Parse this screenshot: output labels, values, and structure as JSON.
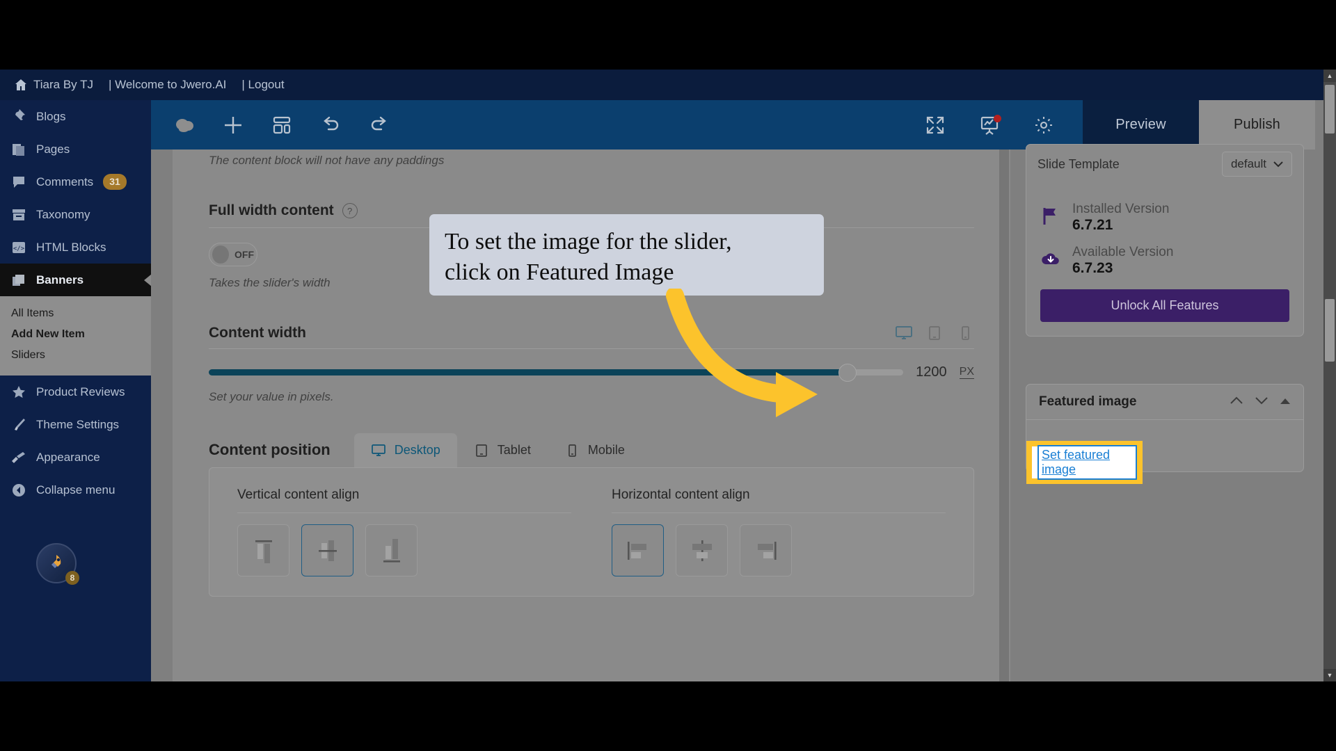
{
  "adminbar": {
    "site_title": "Tiara By TJ",
    "welcome": "| Welcome to Jwero.AI",
    "logout": "| Logout"
  },
  "sidebar": {
    "items": [
      {
        "label": "Blogs",
        "icon": "pin-icon",
        "badge": null,
        "current": false
      },
      {
        "label": "Pages",
        "icon": "pages-icon",
        "badge": null,
        "current": false
      },
      {
        "label": "Comments",
        "icon": "comment-icon",
        "badge": "31",
        "current": false
      },
      {
        "label": "Taxonomy",
        "icon": "archive-icon",
        "badge": null,
        "current": false
      },
      {
        "label": "HTML Blocks",
        "icon": "code-icon",
        "badge": null,
        "current": false
      },
      {
        "label": "Banners",
        "icon": "layers-icon",
        "badge": null,
        "current": true
      }
    ],
    "submenu": [
      {
        "label": "All Items",
        "bold": false
      },
      {
        "label": "Add New Item",
        "bold": true
      },
      {
        "label": "Sliders",
        "bold": false
      }
    ],
    "items_after": [
      {
        "label": "Product Reviews",
        "icon": "star-icon"
      },
      {
        "label": "Theme Settings",
        "icon": "brush-icon"
      },
      {
        "label": "Appearance",
        "icon": "paintroller-icon"
      },
      {
        "label": "Collapse menu",
        "icon": "collapse-icon"
      }
    ],
    "rocket_badge": "8"
  },
  "toolbar": {
    "left_icons": [
      "cloud-save-icon",
      "plus-icon",
      "layout-icon",
      "undo-icon",
      "redo-icon"
    ],
    "right_icons": [
      "fullscreen-icon",
      "stats-icon",
      "gear-icon"
    ],
    "preview_label": "Preview",
    "publish_label": "Publish"
  },
  "main": {
    "paddings_hint": "The content block will not have any paddings",
    "full_width": {
      "title": "Full width content",
      "help": "?",
      "toggle_state": "OFF",
      "hint": "Takes the slider's width"
    },
    "content_width": {
      "title": "Content width",
      "value": "1200",
      "unit": "PX",
      "hint": "Set your value in pixels.",
      "fill_percent": 92
    },
    "content_position": {
      "label": "Content position",
      "tabs": [
        {
          "label": "Desktop",
          "icon": "desktop-icon",
          "active": true
        },
        {
          "label": "Tablet",
          "icon": "tablet-icon",
          "active": false
        },
        {
          "label": "Mobile",
          "icon": "mobile-icon",
          "active": false
        }
      ],
      "vertical_align": {
        "title": "Vertical content align",
        "options": [
          "top",
          "middle",
          "bottom"
        ],
        "selected_index": 1
      },
      "horizontal_align": {
        "title": "Horizontal content align",
        "options": [
          "left",
          "center",
          "right"
        ],
        "selected_index": 0
      }
    }
  },
  "rightbar": {
    "slide_template": {
      "label": "Slide Template",
      "value": "default"
    },
    "installed": {
      "label": "Installed Version",
      "value": "6.7.21",
      "icon": "flag-icon"
    },
    "available": {
      "label": "Available Version",
      "value": "6.7.23",
      "icon": "cloud-download-icon"
    },
    "unlock_label": "Unlock All Features",
    "featured_image": {
      "title": "Featured image",
      "link_label": "Set featured image",
      "controls": [
        "chevron-up-icon",
        "chevron-down-icon",
        "caret-up-icon"
      ]
    }
  },
  "callout": {
    "line1": "To set the image for the slider,",
    "line2": "click on Featured Image"
  },
  "colors": {
    "admin_navy": "#0b1c3d",
    "sidebar_navy": "#0d2048",
    "toolbar_blue": "#0b3f6e",
    "accent_teal": "#0d5778",
    "purple": "#3b1f67",
    "highlight_yellow": "#fcc32c",
    "link_blue": "#1a7fd4",
    "badge_gold": "#a5792a"
  }
}
